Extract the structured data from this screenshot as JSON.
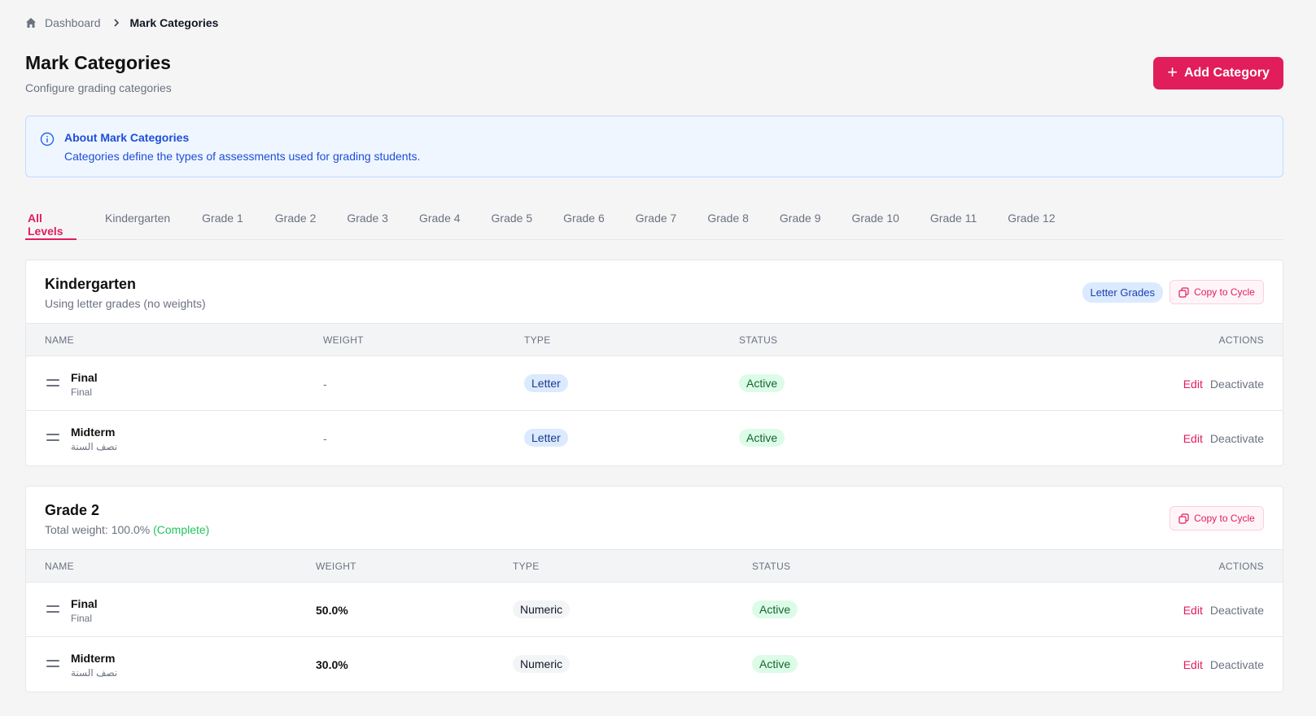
{
  "breadcrumb": {
    "home": "Dashboard",
    "current": "Mark Categories"
  },
  "header": {
    "title": "Mark Categories",
    "subtitle": "Configure grading categories",
    "add_label": "Add Category"
  },
  "info": {
    "title": "About Mark Categories",
    "text": "Categories define the types of assessments used for grading students."
  },
  "tabs": [
    "All Levels",
    "Kindergarten",
    "Grade 1",
    "Grade 2",
    "Grade 3",
    "Grade 4",
    "Grade 5",
    "Grade 6",
    "Grade 7",
    "Grade 8",
    "Grade 9",
    "Grade 10",
    "Grade 11",
    "Grade 12"
  ],
  "active_tab": "All Levels",
  "columns": {
    "name": "NAME",
    "weight": "WEIGHT",
    "type": "TYPE",
    "status": "STATUS",
    "actions": "ACTIONS"
  },
  "actions": {
    "edit": "Edit",
    "deactivate": "Deactivate",
    "copy": "Copy to Cycle"
  },
  "colors": {
    "accent": "#e11d5c",
    "info": "#1d4ed8",
    "success": "#22c55e"
  },
  "cards": [
    {
      "title": "Kindergarten",
      "subtitle": "Using letter grades (no weights)",
      "badge": "Letter Grades",
      "rows": [
        {
          "name": "Final",
          "alt": "Final",
          "weight": "-",
          "type": "Letter",
          "status": "Active"
        },
        {
          "name": "Midterm",
          "alt": "نصف السنة",
          "weight": "-",
          "type": "Letter",
          "status": "Active"
        }
      ]
    },
    {
      "title": "Grade 2",
      "subtitle_prefix": "Total weight: 100.0%",
      "subtitle_status": "(Complete)",
      "rows": [
        {
          "name": "Final",
          "alt": "Final",
          "weight": "50.0%",
          "type": "Numeric",
          "status": "Active"
        },
        {
          "name": "Midterm",
          "alt": "نصف السنة",
          "weight": "30.0%",
          "type": "Numeric",
          "status": "Active"
        }
      ]
    }
  ]
}
